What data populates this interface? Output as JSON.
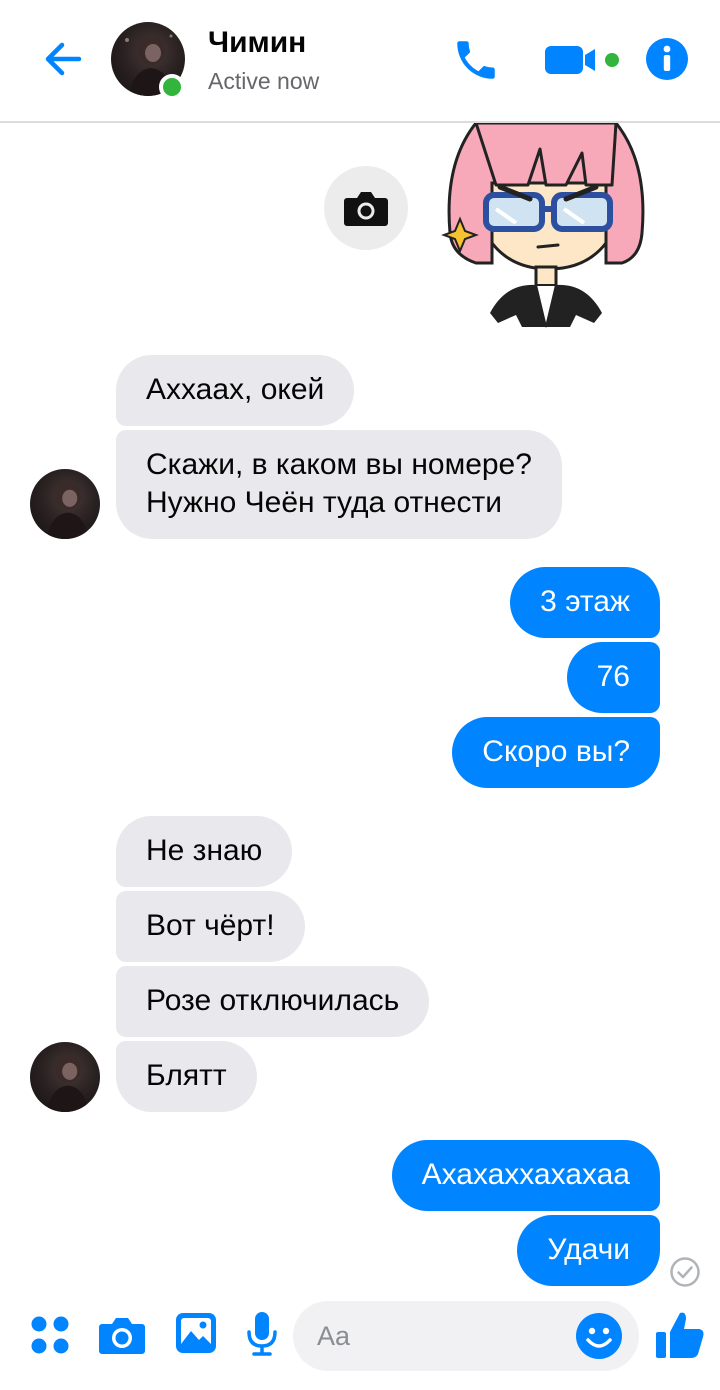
{
  "header": {
    "contact_name": "Чимин",
    "status": "Active now",
    "accent_color": "#0084ff",
    "online_color": "#31b53d",
    "icons": [
      "back-arrow-icon",
      "phone-icon",
      "video-camera-icon",
      "info-icon"
    ]
  },
  "messages": [
    {
      "direction": "incoming",
      "text": "Аххаах, окей"
    },
    {
      "direction": "incoming",
      "text": "Скажи, в каком вы номере?"
    },
    {
      "direction": "incoming",
      "text": "Нужно Чеён туда отнести"
    },
    {
      "direction": "outgoing",
      "text": "3 этаж"
    },
    {
      "direction": "outgoing",
      "text": "76"
    },
    {
      "direction": "outgoing",
      "text": "Скоро вы?"
    },
    {
      "direction": "incoming",
      "text": "Не знаю"
    },
    {
      "direction": "incoming",
      "text": "Вот чёрт!"
    },
    {
      "direction": "incoming",
      "text": "Розе отключилась"
    },
    {
      "direction": "incoming",
      "text": "Блятт"
    },
    {
      "direction": "outgoing",
      "text": "Ахахаххахахаа"
    },
    {
      "direction": "outgoing",
      "text": "Удачи"
    }
  ],
  "colors": {
    "incoming_bubble": "#e9e8ed",
    "outgoing_bubble": "#0084ff"
  },
  "composer": {
    "placeholder": "Aa",
    "icons": [
      "four-dots-icon",
      "camera-icon",
      "image-icon",
      "microphone-icon",
      "smiley-icon",
      "thumbs-up-icon"
    ]
  }
}
